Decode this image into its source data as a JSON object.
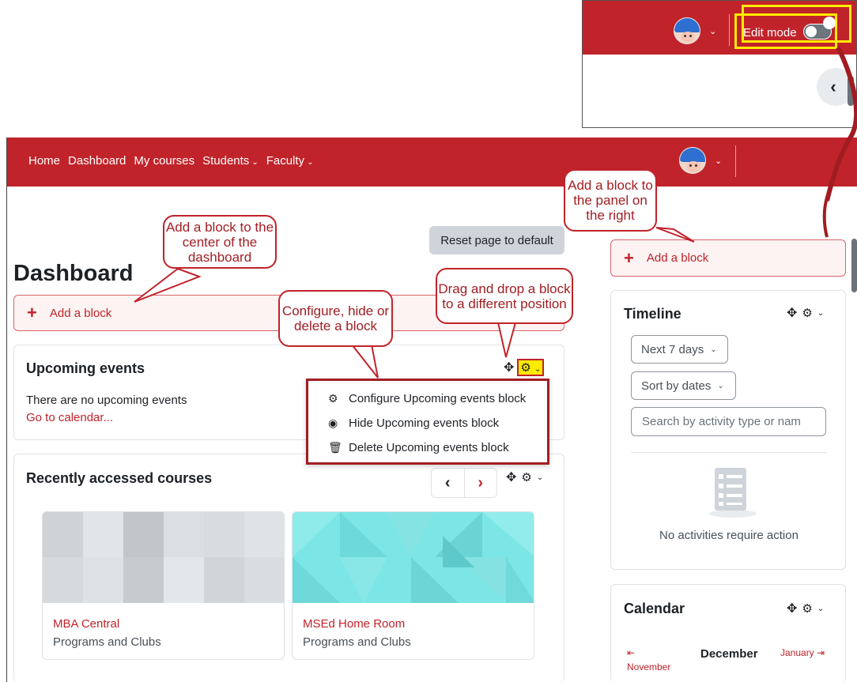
{
  "inset": {
    "edit_mode_label": "Edit mode",
    "back_chevron": "‹"
  },
  "nav": {
    "links": [
      "Home",
      "Dashboard",
      "My courses",
      "Students",
      "Faculty"
    ],
    "caret": "⌄"
  },
  "page": {
    "title": "Dashboard",
    "reset_button": "Reset page to default",
    "add_block_label": "Add a block",
    "add_block_icon": "+"
  },
  "upcoming": {
    "title": "Upcoming events",
    "empty_text": "There are no upcoming events",
    "calendar_link": "Go to calendar..."
  },
  "block_menu": {
    "items": [
      {
        "icon": "cog-icon",
        "label": "Configure Upcoming events block"
      },
      {
        "icon": "eye-icon",
        "label": "Hide Upcoming events block"
      },
      {
        "icon": "trash-icon",
        "label": "Delete Upcoming events block"
      }
    ]
  },
  "recent": {
    "title": "Recently accessed courses",
    "courses": [
      {
        "name": "MBA Central",
        "category": "Programs and Clubs",
        "color": "#d5d8da"
      },
      {
        "name": "MSEd Home Room",
        "category": "Programs and Clubs",
        "color": "#7ce6e6"
      }
    ]
  },
  "timeline": {
    "title": "Timeline",
    "filter": "Next 7 days",
    "sort": "Sort by dates",
    "search_placeholder": "Search by activity type or nam",
    "empty_text": "No activities require action"
  },
  "calendar": {
    "title": "Calendar",
    "month": "December",
    "prev": "November",
    "next": "January"
  },
  "callouts": {
    "center": "Add a block to the center of the dashboard",
    "right": "Add a block to the panel on the right",
    "configure": "Configure, hide or delete a block",
    "drag": "Drag and drop a block to a different position"
  },
  "colors": {
    "brand": "#c1232a",
    "highlight": "#ffeb00"
  }
}
